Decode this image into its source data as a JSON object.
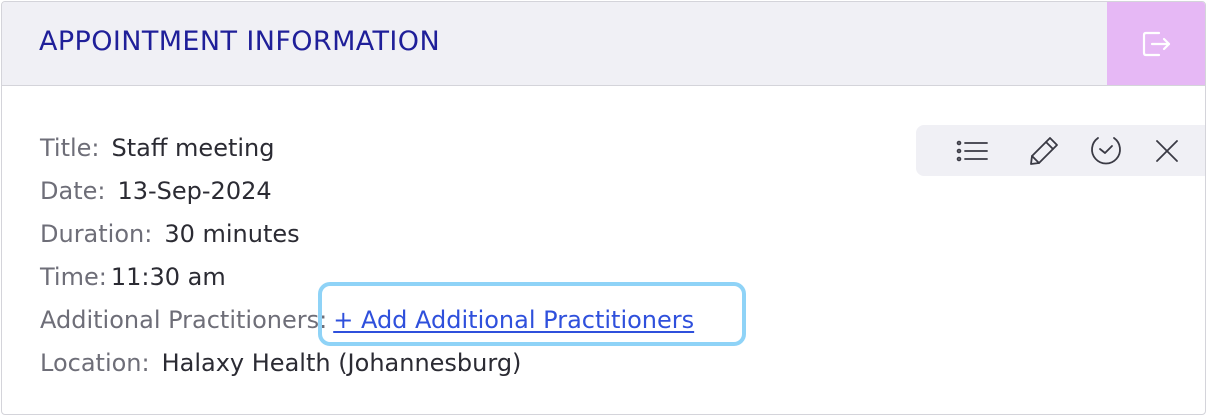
{
  "header": {
    "title": "APPOINTMENT INFORMATION",
    "exit_icon": "exit-icon"
  },
  "toolbar": {
    "icons": [
      "list-icon",
      "pencil-icon",
      "clock-check-icon",
      "close-icon"
    ]
  },
  "appointment": {
    "title_label": "Title:",
    "title_value": "Staff meeting",
    "date_label": "Date:",
    "date_value": "13-Sep-2024",
    "duration_label": "Duration:",
    "duration_value": "30 minutes",
    "time_label": "Time:",
    "time_value": "11:30 am",
    "practitioners_label": "Additional Practitioners:",
    "practitioners_link": "+ Add Additional Practitioners",
    "location_label": "Location:",
    "location_value": "Halaxy Health (Johannesburg)"
  },
  "colors": {
    "header_bg": "#f0f0f5",
    "title": "#1f1f99",
    "exit_bg": "#e6b8f5",
    "link": "#2f50dc",
    "focus_ring": "#8fd3f7"
  }
}
